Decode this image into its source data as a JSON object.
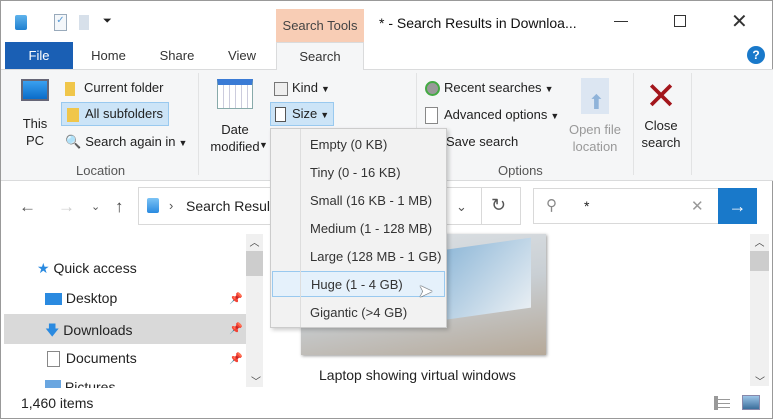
{
  "window": {
    "title": "* - Search Results in Downloa...",
    "contextual_tab_header": "Search Tools"
  },
  "tabs": [
    {
      "label": "File"
    },
    {
      "label": "Home"
    },
    {
      "label": "Share"
    },
    {
      "label": "View"
    },
    {
      "label": "Search"
    }
  ],
  "ribbon": {
    "location": {
      "this_pc": "This PC",
      "current_folder": "Current folder",
      "all_subfolders": "All subfolders",
      "search_again_in": "Search again in",
      "group": "Location"
    },
    "refine": {
      "date_modified": "Date modified",
      "kind": "Kind",
      "size": "Size"
    },
    "options": {
      "recent_searches": "Recent searches",
      "advanced_options": "Advanced options",
      "save_search": "Save search",
      "open_file_location": "Open file location",
      "group": "Options"
    },
    "close": {
      "close_search": "Close search"
    }
  },
  "size_menu": [
    {
      "label": "Empty (0 KB)"
    },
    {
      "label": "Tiny (0 - 16 KB)"
    },
    {
      "label": "Small (16 KB - 1 MB)"
    },
    {
      "label": "Medium (1 - 128 MB)"
    },
    {
      "label": "Large (128 MB - 1 GB)"
    },
    {
      "label": "Huge (1 - 4 GB)"
    },
    {
      "label": "Gigantic (>4 GB)"
    }
  ],
  "address": {
    "path": "Search Results in Downloads",
    "search_value": "*"
  },
  "nav": [
    {
      "label": "Quick access"
    },
    {
      "label": "Desktop"
    },
    {
      "label": "Downloads"
    },
    {
      "label": "Documents"
    },
    {
      "label": "Pictures"
    }
  ],
  "content": {
    "item_caption": "Laptop showing virtual windows"
  },
  "status": {
    "count": "1,460 items"
  },
  "colors": {
    "accent": "#1979ca",
    "file_tab": "#1a5fb4",
    "search_tools": "#f8cdb5",
    "close_x": "#a3161c"
  }
}
